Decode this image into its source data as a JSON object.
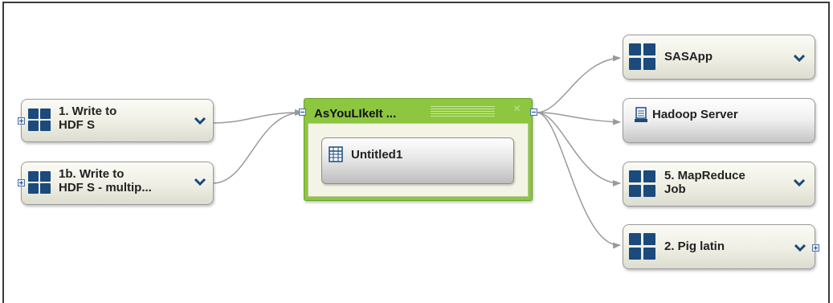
{
  "flow": {
    "left_nodes": [
      {
        "label": "1. Write to\nHDF S",
        "icon": "grid-icon",
        "has_dropdown": true,
        "has_expand": true
      },
      {
        "label": "1b. Write to\nHDF S - multip...",
        "icon": "grid-icon",
        "has_dropdown": true,
        "has_expand": true
      }
    ],
    "container": {
      "title": "AsYouLIkeIt ...",
      "close_glyph": "×",
      "color": "#8dc63f",
      "inner_node": {
        "label": "Untitled1",
        "icon": "table-icon"
      }
    },
    "right_nodes": [
      {
        "label": "SASApp",
        "icon": "grid-icon",
        "has_dropdown": true
      },
      {
        "label": "Hadoop  Server",
        "icon": "server-icon",
        "has_dropdown": false
      },
      {
        "label": "5. MapReduce\nJob",
        "icon": "grid-icon",
        "has_dropdown": true
      },
      {
        "label": "2. Pig latin",
        "icon": "grid-icon",
        "has_dropdown": true,
        "has_expand": true
      }
    ]
  },
  "colors": {
    "icon_blue": "#1b4a7c",
    "connector_gray": "#9a9a9a",
    "container_green": "#8dc63f"
  }
}
